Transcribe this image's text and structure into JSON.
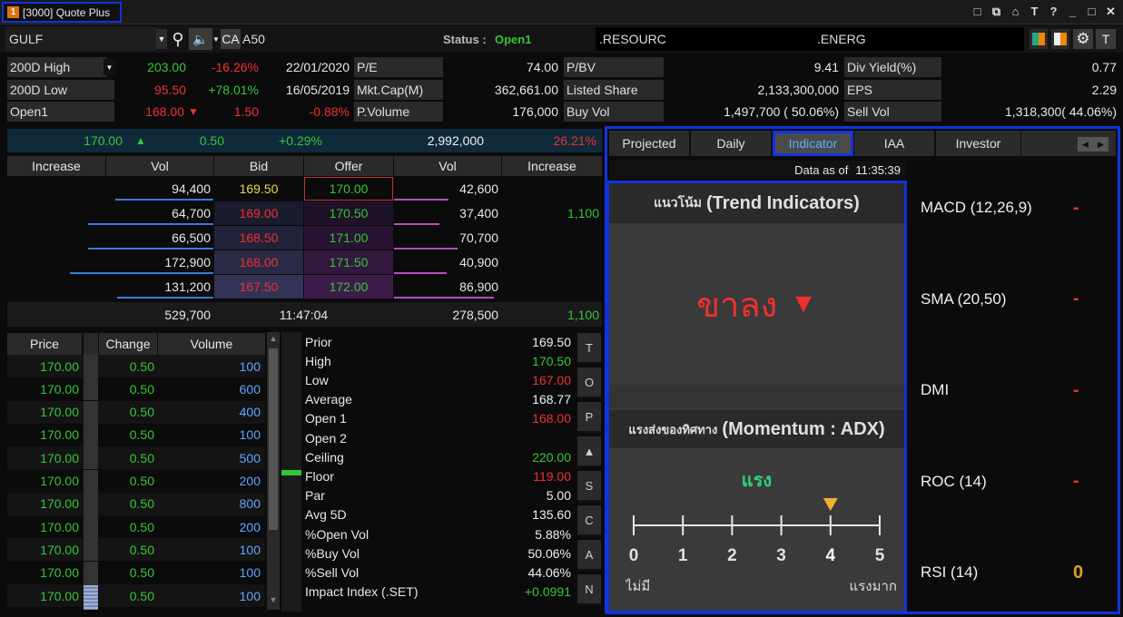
{
  "window": {
    "number": "1",
    "title": "[3000] Quote Plus",
    "controls": [
      "□",
      "⧉",
      "⌂",
      "T",
      "?",
      "_",
      "□",
      "✕"
    ]
  },
  "symbol_bar": {
    "symbol": "GULF",
    "ca": "CA",
    "ca_value": "A50",
    "status_label": "Status :",
    "status_value": "Open1",
    "sector": ".RESOURC",
    "industry": ".ENERG",
    "t_button": "T"
  },
  "quote": {
    "r1": {
      "label": "200D High",
      "price": "203.00",
      "pct": "-16.26%",
      "date": "22/01/2020",
      "k1": "P/E",
      "v1": "74.00",
      "k2": "P/BV",
      "v2": "9.41",
      "k3": "Div Yield(%)",
      "v3": "0.77"
    },
    "r2": {
      "label": "200D Low",
      "price": "95.50",
      "pct": "+78.01%",
      "date": "16/05/2019",
      "k1": "Mkt.Cap(M)",
      "v1": "362,661.00",
      "k2": "Listed Share",
      "v2": "2,133,300,000",
      "k3": "EPS",
      "v3": "2.29"
    },
    "r3": {
      "label": "Open1",
      "price": "168.00",
      "arrow": "▼",
      "chg": "1.50",
      "pct": "-0.88%",
      "k1": "P.Volume",
      "v1": "176,000",
      "k2": "Buy Vol",
      "v2": "1,497,700 ( 50.06%)",
      "k3": "Sell Vol",
      "v3": "1,318,300( 44.06%)"
    }
  },
  "last": {
    "price": "170.00",
    "arrow": "▲",
    "change": "0.50",
    "pct": "+0.29%",
    "volume": "2,992,000",
    "ratio": "26.21%"
  },
  "orderbook": {
    "headers": [
      "Increase",
      "Vol",
      "Bid",
      "Offer",
      "Vol",
      "Increase"
    ],
    "rows": [
      {
        "bid_vol": "94,400",
        "bid": "169.50",
        "offer": "170.00",
        "offer_vol": "42,600",
        "inc_r": ""
      },
      {
        "bid_vol": "64,700",
        "bid": "169.00",
        "offer": "170.50",
        "offer_vol": "37,400",
        "inc_r": "1,100"
      },
      {
        "bid_vol": "66,500",
        "bid": "168.50",
        "offer": "171.00",
        "offer_vol": "70,700",
        "inc_r": ""
      },
      {
        "bid_vol": "172,900",
        "bid": "168.00",
        "offer": "171.50",
        "offer_vol": "40,900",
        "inc_r": ""
      },
      {
        "bid_vol": "131,200",
        "bid": "167.50",
        "offer": "172.00",
        "offer_vol": "86,900",
        "inc_r": ""
      }
    ],
    "totals": {
      "bid_vol": "529,700",
      "time": "11:47:04",
      "offer_vol": "278,500",
      "inc_r": "1,100"
    }
  },
  "ticker": {
    "headers": [
      "Price",
      "Change",
      "Volume"
    ],
    "rows": [
      {
        "price": "170.00",
        "change": "0.50",
        "volume": "100"
      },
      {
        "price": "170.00",
        "change": "0.50",
        "volume": "600"
      },
      {
        "price": "170.00",
        "change": "0.50",
        "volume": "400"
      },
      {
        "price": "170.00",
        "change": "0.50",
        "volume": "100"
      },
      {
        "price": "170.00",
        "change": "0.50",
        "volume": "500"
      },
      {
        "price": "170.00",
        "change": "0.50",
        "volume": "200"
      },
      {
        "price": "170.00",
        "change": "0.50",
        "volume": "800"
      },
      {
        "price": "170.00",
        "change": "0.50",
        "volume": "200"
      },
      {
        "price": "170.00",
        "change": "0.50",
        "volume": "100"
      },
      {
        "price": "170.00",
        "change": "0.50",
        "volume": "100"
      },
      {
        "price": "170.00",
        "change": "0.50",
        "volume": "100"
      }
    ]
  },
  "stats": [
    {
      "label": "Prior",
      "value": "169.50",
      "color": "#f0f0f0"
    },
    {
      "label": "High",
      "value": "170.50",
      "color": "#35c635"
    },
    {
      "label": "Low",
      "value": "167.00",
      "color": "#f03030"
    },
    {
      "label": "Average",
      "value": "168.77",
      "color": "#f0f0f0"
    },
    {
      "label": "Open 1",
      "value": "168.00",
      "color": "#f03030"
    },
    {
      "label": "Open 2",
      "value": "",
      "color": "#f0f0f0"
    },
    {
      "label": "Ceiling",
      "value": "220.00",
      "color": "#35c635"
    },
    {
      "label": "Floor",
      "value": "119.00",
      "color": "#f03030"
    },
    {
      "label": "Par",
      "value": "5.00",
      "color": "#f0f0f0"
    },
    {
      "label": "Avg 5D",
      "value": "135.60",
      "color": "#f0f0f0"
    },
    {
      "label": "%Open Vol",
      "value": "5.88%",
      "color": "#f0f0f0"
    },
    {
      "label": "%Buy Vol",
      "value": "50.06%",
      "color": "#f0f0f0"
    },
    {
      "label": "%Sell Vol",
      "value": "44.06%",
      "color": "#f0f0f0"
    },
    {
      "label": "Impact Index (.SET)",
      "value": "+0.0991",
      "color": "#35c635"
    }
  ],
  "side_buttons": [
    "T",
    "O",
    "P",
    "▲",
    "S",
    "C",
    "A",
    "N"
  ],
  "tabs": [
    "Projected",
    "Daily",
    "Indicator",
    "IAA",
    "Investor"
  ],
  "indicator": {
    "data_as_of_label": "Data as of",
    "data_as_of_time": "11:35:39",
    "trend_title_th": "แนวโน้ม",
    "trend_title_en": "(Trend Indicators)",
    "trend_value": "ขาลง",
    "trend_arrow": "▼",
    "momentum_title_th": "แรงส่งของทิศทาง",
    "momentum_title_en": "(Momentum : ADX)",
    "momentum_value": "แรง",
    "adx_level": 4,
    "scale_labels": [
      "0",
      "1",
      "2",
      "3",
      "4",
      "5"
    ],
    "scale_left": "ไม่มี",
    "scale_right": "แรงมาก",
    "list": [
      {
        "name": "MACD (12,26,9)",
        "value": "-",
        "color": "#f03030"
      },
      {
        "name": "SMA (20,50)",
        "value": "-",
        "color": "#f03030"
      },
      {
        "name": "DMI",
        "value": "-",
        "color": "#f03030"
      },
      {
        "name": "ROC (14)",
        "value": "-",
        "color": "#f03030"
      },
      {
        "name": "RSI (14)",
        "value": "0",
        "color": "#e0a020"
      }
    ]
  }
}
